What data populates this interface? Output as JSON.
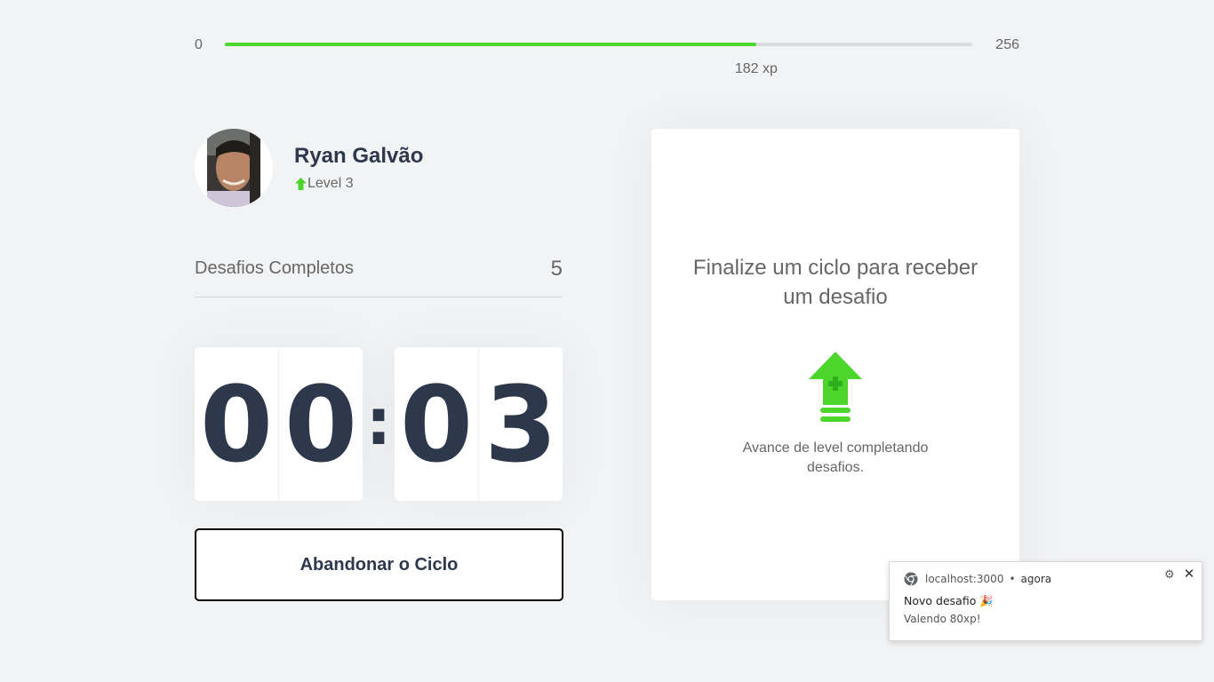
{
  "xp": {
    "min": "0",
    "max": "256",
    "current_label": "182 xp",
    "current": 182,
    "total": 256,
    "fill_color": "#4cd62b"
  },
  "profile": {
    "name": "Ryan Galvão",
    "level_label": "Level 3",
    "level_icon": "level-up-arrow-icon"
  },
  "completed": {
    "label": "Desafios Completos",
    "count": "5"
  },
  "countdown": {
    "minute_left": "0",
    "minute_right": "0",
    "separator": ":",
    "second_left": "0",
    "second_right": "3"
  },
  "actions": {
    "abandon_label": "Abandonar o Ciclo"
  },
  "challenge": {
    "title": "Finalize um ciclo para receber um desafio",
    "hint": "Avance de level completando desafios.",
    "icon": "level-up-icon"
  },
  "notification": {
    "source": "localhost:3000",
    "separator": "•",
    "time": "agora",
    "title": "Novo desafio 🎉",
    "body": "Valendo 80xp!"
  },
  "colors": {
    "background": "#f2f3f5",
    "accent_green": "#4cd62b",
    "title_dark": "#2e384d",
    "text": "#666666"
  }
}
